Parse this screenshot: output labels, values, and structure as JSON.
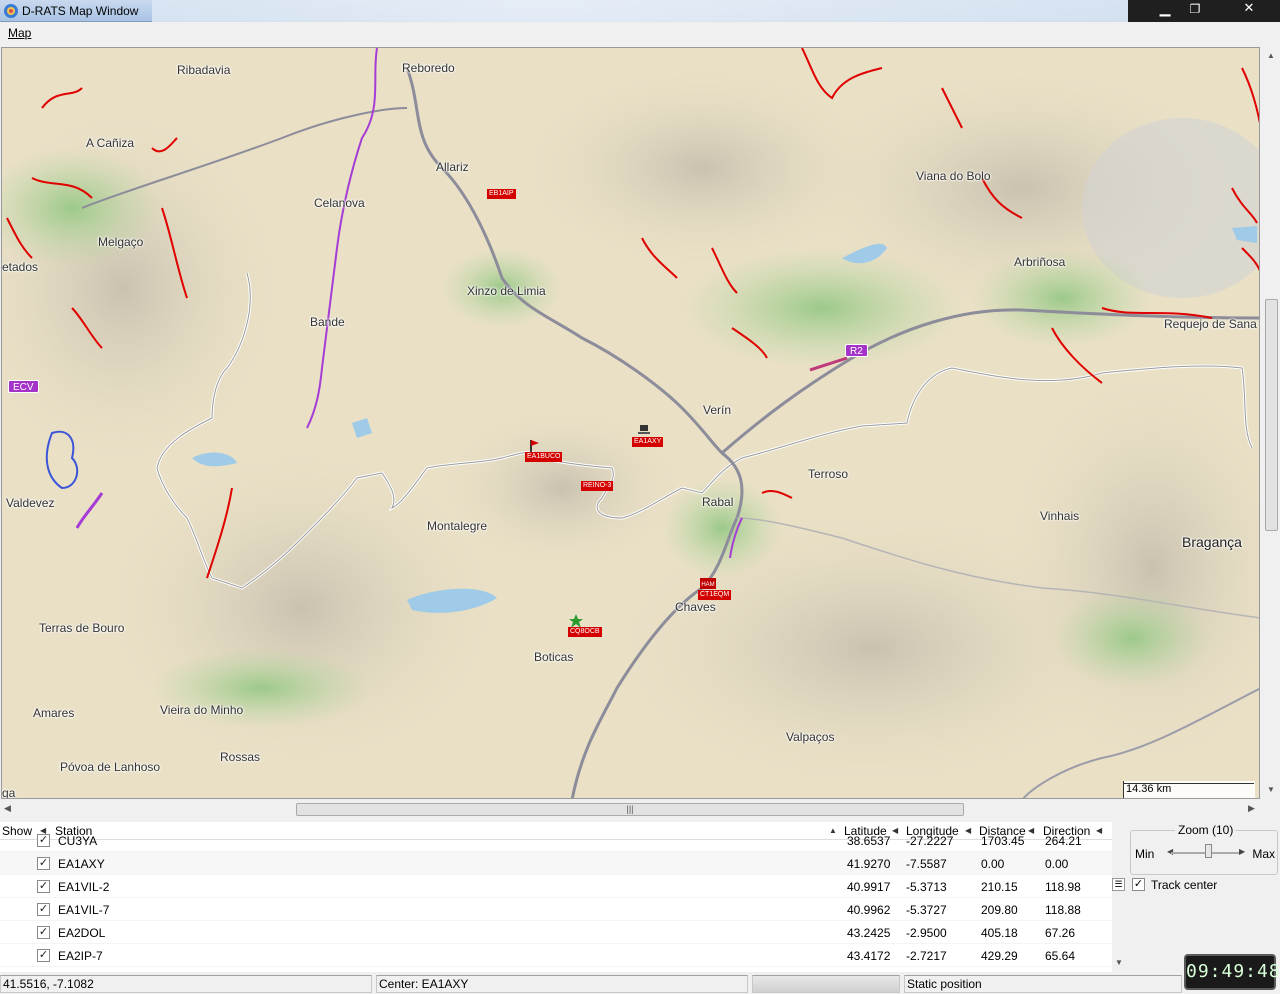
{
  "window": {
    "title": "D-RATS Map Window",
    "minimize": "▁",
    "maximize": "❐",
    "close": "✕"
  },
  "menu": {
    "map_label": "Map"
  },
  "map": {
    "places": [
      {
        "name": "Ribadavia"
      },
      {
        "name": "Reboredo"
      },
      {
        "name": "A Cañiza"
      },
      {
        "name": "Allariz"
      },
      {
        "name": "Celanova"
      },
      {
        "name": "Melgaço"
      },
      {
        "name": "etados"
      },
      {
        "name": "Viana do Bolo"
      },
      {
        "name": "Arbriñosa"
      },
      {
        "name": "Xinzo de Limia"
      },
      {
        "name": "Bande"
      },
      {
        "name": "Requejo de Sana"
      },
      {
        "name": "Verín"
      },
      {
        "name": "Terroso"
      },
      {
        "name": "Valdevez"
      },
      {
        "name": "Rabal"
      },
      {
        "name": "Vinhais"
      },
      {
        "name": "Montalegre"
      },
      {
        "name": "Bragança"
      },
      {
        "name": "Chaves"
      },
      {
        "name": "Terras de Bouro"
      },
      {
        "name": "Boticas"
      },
      {
        "name": "Amares"
      },
      {
        "name": "Vieira do Minho"
      },
      {
        "name": "Valpaços"
      },
      {
        "name": "Rossas"
      },
      {
        "name": "Póvoa de Lanhoso"
      },
      {
        "name": "ga"
      }
    ],
    "road_shields": [
      {
        "label": "ECV"
      },
      {
        "label": "R2"
      }
    ],
    "stations": [
      {
        "label": "EB1AIP"
      },
      {
        "label": "EA1AXY"
      },
      {
        "label": "EA1BUCO"
      },
      {
        "label": "REINO-3"
      },
      {
        "label": "CT1EQM"
      },
      {
        "label": "CQ8OCB"
      }
    ],
    "scale_label": "14.36 km"
  },
  "table": {
    "columns": {
      "show": "Show",
      "station": "Station",
      "latitude": "Latitude",
      "longitude": "Longitude",
      "distance": "Distance",
      "direction": "Direction"
    },
    "rows": [
      {
        "station": "CU3YA",
        "lat": "38.6537",
        "lon": "-27.2227",
        "dist": "1703.45",
        "dir": "264.21",
        "checked": true
      },
      {
        "station": "EA1AXY",
        "lat": "41.9270",
        "lon": "-7.5587",
        "dist": "0.00",
        "dir": "0.00",
        "checked": true
      },
      {
        "station": "EA1VIL-2",
        "lat": "40.9917",
        "lon": "-5.3713",
        "dist": "210.15",
        "dir": "118.98",
        "checked": true
      },
      {
        "station": "EA1VIL-7",
        "lat": "40.9962",
        "lon": "-5.3727",
        "dist": "209.80",
        "dir": "118.88",
        "checked": true
      },
      {
        "station": "EA2DOL",
        "lat": "43.2425",
        "lon": "-2.9500",
        "dist": "405.18",
        "dir": "67.26",
        "checked": true
      },
      {
        "station": "EA2IP-7",
        "lat": "43.4172",
        "lon": "-2.7217",
        "dist": "429.29",
        "dir": "65.64",
        "checked": true
      }
    ]
  },
  "zoom": {
    "legend": "Zoom (10)",
    "min": "Min",
    "max": "Max",
    "level": 10
  },
  "track_center": {
    "label": "Track center",
    "checked": true
  },
  "status": {
    "coords": "41.5516, -7.1082",
    "center": "Center: EA1AXY",
    "mode": "Static position"
  },
  "clock": "09:49:48",
  "check_glyph": "✓"
}
